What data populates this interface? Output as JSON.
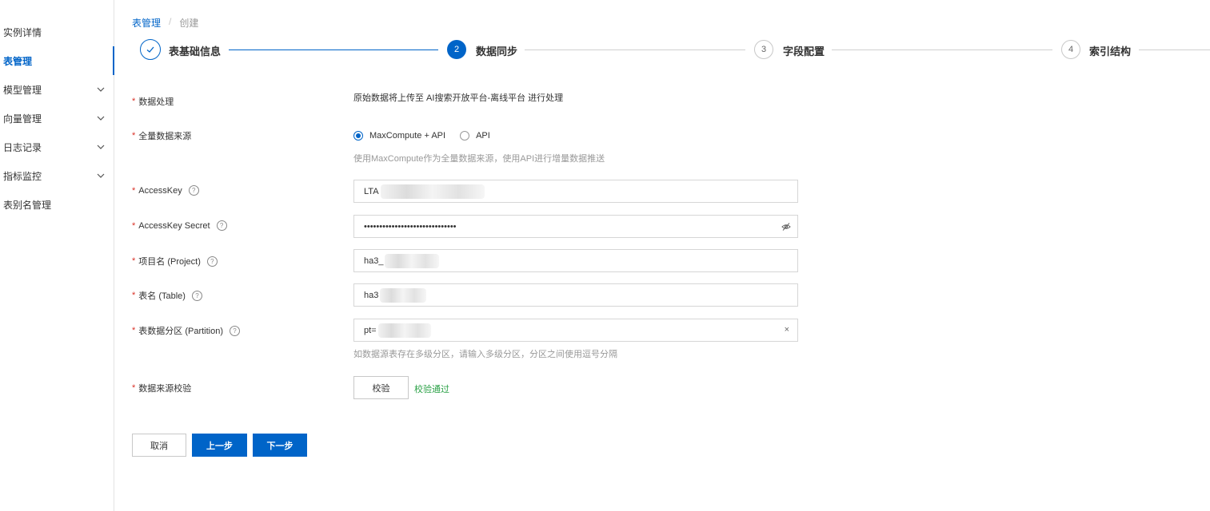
{
  "sidebar": {
    "items": [
      {
        "label": "实例详情",
        "expandable": false,
        "active": false
      },
      {
        "label": "表管理",
        "expandable": false,
        "active": true
      },
      {
        "label": "模型管理",
        "expandable": true,
        "active": false
      },
      {
        "label": "向量管理",
        "expandable": true,
        "active": false
      },
      {
        "label": "日志记录",
        "expandable": true,
        "active": false
      },
      {
        "label": "指标监控",
        "expandable": true,
        "active": false
      },
      {
        "label": "表别名管理",
        "expandable": false,
        "active": false
      }
    ]
  },
  "breadcrumb": {
    "link": "表管理",
    "separator": "/",
    "current": "创建"
  },
  "steps": [
    {
      "number": "1",
      "label": "表基础信息",
      "state": "done"
    },
    {
      "number": "2",
      "label": "数据同步",
      "state": "current"
    },
    {
      "number": "3",
      "label": "字段配置",
      "state": "todo"
    },
    {
      "number": "4",
      "label": "索引结构",
      "state": "todo"
    }
  ],
  "form": {
    "data_processing": {
      "label": "数据处理",
      "value": "原始数据将上传至 AI搜索开放平台-离线平台 进行处理"
    },
    "full_data_source": {
      "label": "全量数据来源",
      "options": [
        "MaxCompute + API",
        "API"
      ],
      "selected": "MaxCompute + API",
      "hint": "使用MaxCompute作为全量数据来源，使用API进行增量数据推送"
    },
    "access_key": {
      "label": "AccessKey",
      "value": "LTA"
    },
    "access_key_secret": {
      "label": "AccessKey Secret",
      "value": "••••••••••••••••••••••••••••••"
    },
    "project": {
      "label": "项目名 (Project)",
      "value": "ha3_"
    },
    "table": {
      "label": "表名 (Table)",
      "value": "ha3"
    },
    "partition": {
      "label": "表数据分区 (Partition)",
      "value": "pt=",
      "hint": "如数据源表存在多级分区，请输入多级分区，分区之间使用逗号分隔"
    },
    "verify": {
      "label": "数据来源校验",
      "button": "校验",
      "status": "校验通过"
    }
  },
  "actions": {
    "cancel": "取消",
    "prev": "上一步",
    "next": "下一步"
  },
  "colors": {
    "primary": "#0064c8",
    "success": "#2aa146",
    "required": "#d93026"
  },
  "icons": {
    "help": "?",
    "done": "check-icon",
    "eye": "eye-off-icon",
    "clear": "×"
  }
}
